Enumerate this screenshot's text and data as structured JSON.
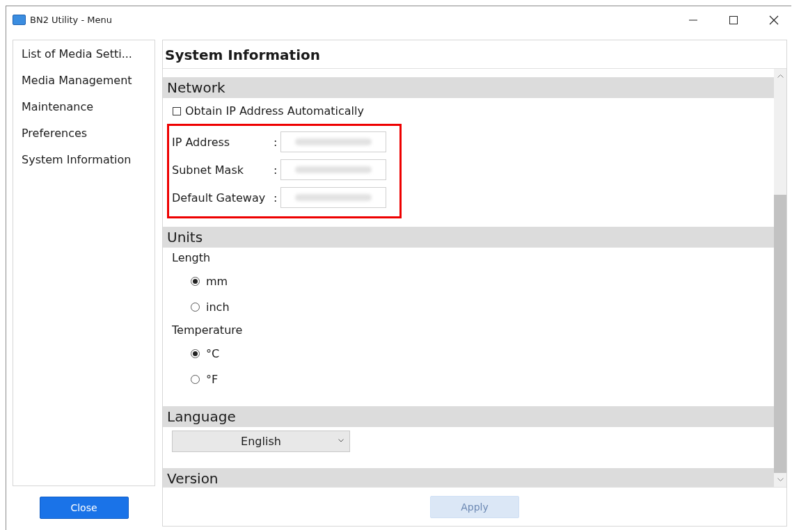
{
  "window": {
    "title": "BN2 Utility - Menu"
  },
  "sidebar": {
    "items": [
      {
        "label": "List of Media Setti..."
      },
      {
        "label": "Media Management"
      },
      {
        "label": "Maintenance"
      },
      {
        "label": "Preferences"
      },
      {
        "label": "System Information"
      }
    ],
    "close_button": "Close"
  },
  "main": {
    "title": "System Information",
    "sections": [
      {
        "kind": "network",
        "title": "Network",
        "auto_ip": {
          "label": "Obtain IP Address Automatically",
          "checked": false
        },
        "fields": [
          {
            "label": "IP Address",
            "colon": ":"
          },
          {
            "label": "Subnet Mask",
            "colon": ":"
          },
          {
            "label": "Default Gateway",
            "colon": ":"
          }
        ],
        "highlighted": true
      },
      {
        "kind": "radios",
        "title": "Units",
        "groups": [
          {
            "label": "Length",
            "options": [
              {
                "label": "mm",
                "selected": true
              },
              {
                "label": "inch",
                "selected": false
              }
            ]
          },
          {
            "label": "Temperature",
            "options": [
              {
                "label": "°C",
                "selected": true
              },
              {
                "label": "°F",
                "selected": false
              }
            ]
          }
        ]
      },
      {
        "kind": "dropdown",
        "title": "Language",
        "value": "English"
      },
      {
        "kind": "text",
        "title": "Version"
      }
    ],
    "apply_button": {
      "label": "Apply",
      "disabled": true
    }
  }
}
